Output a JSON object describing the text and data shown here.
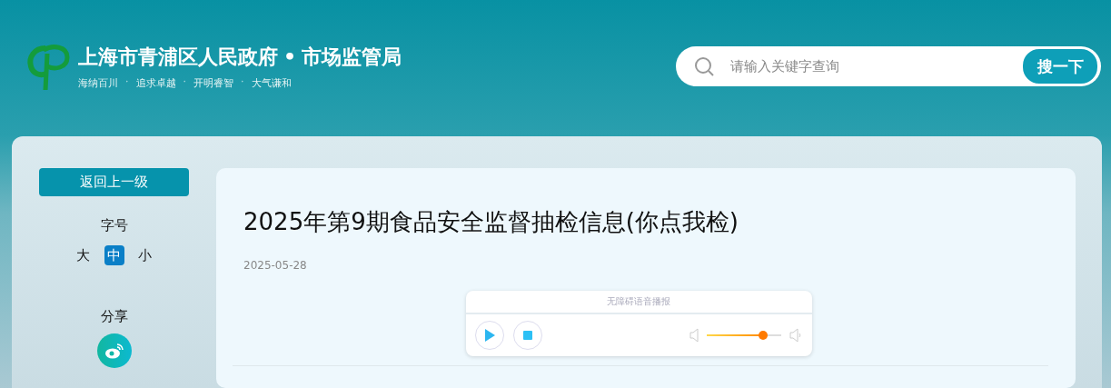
{
  "header": {
    "site_title": "上海市青浦区人民政府",
    "department": "市场监管局",
    "separator": "•",
    "slogans": [
      {
        "text": "海纳百川"
      },
      {
        "separator": "·",
        "text": "追求卓越"
      },
      {
        "separator": "·",
        "text": "开明睿智"
      },
      {
        "separator": "·",
        "text": "大气谦和"
      }
    ],
    "search": {
      "placeholder": "请输入关键字查询",
      "button": "搜一下"
    }
  },
  "sidebar": {
    "back_button": "返回上一级",
    "font_size_label": "字号",
    "font_sizes": [
      {
        "label": "大",
        "selected": false
      },
      {
        "label": "中",
        "selected": true
      },
      {
        "label": "小",
        "selected": false
      }
    ],
    "share_label": "分享"
  },
  "article": {
    "title": "2025年第9期食品安全监督抽检信息(你点我检)",
    "date": "2025-05-28",
    "player": {
      "title": "无障碍语音播报",
      "volume": {
        "level": 0.76
      }
    }
  }
}
